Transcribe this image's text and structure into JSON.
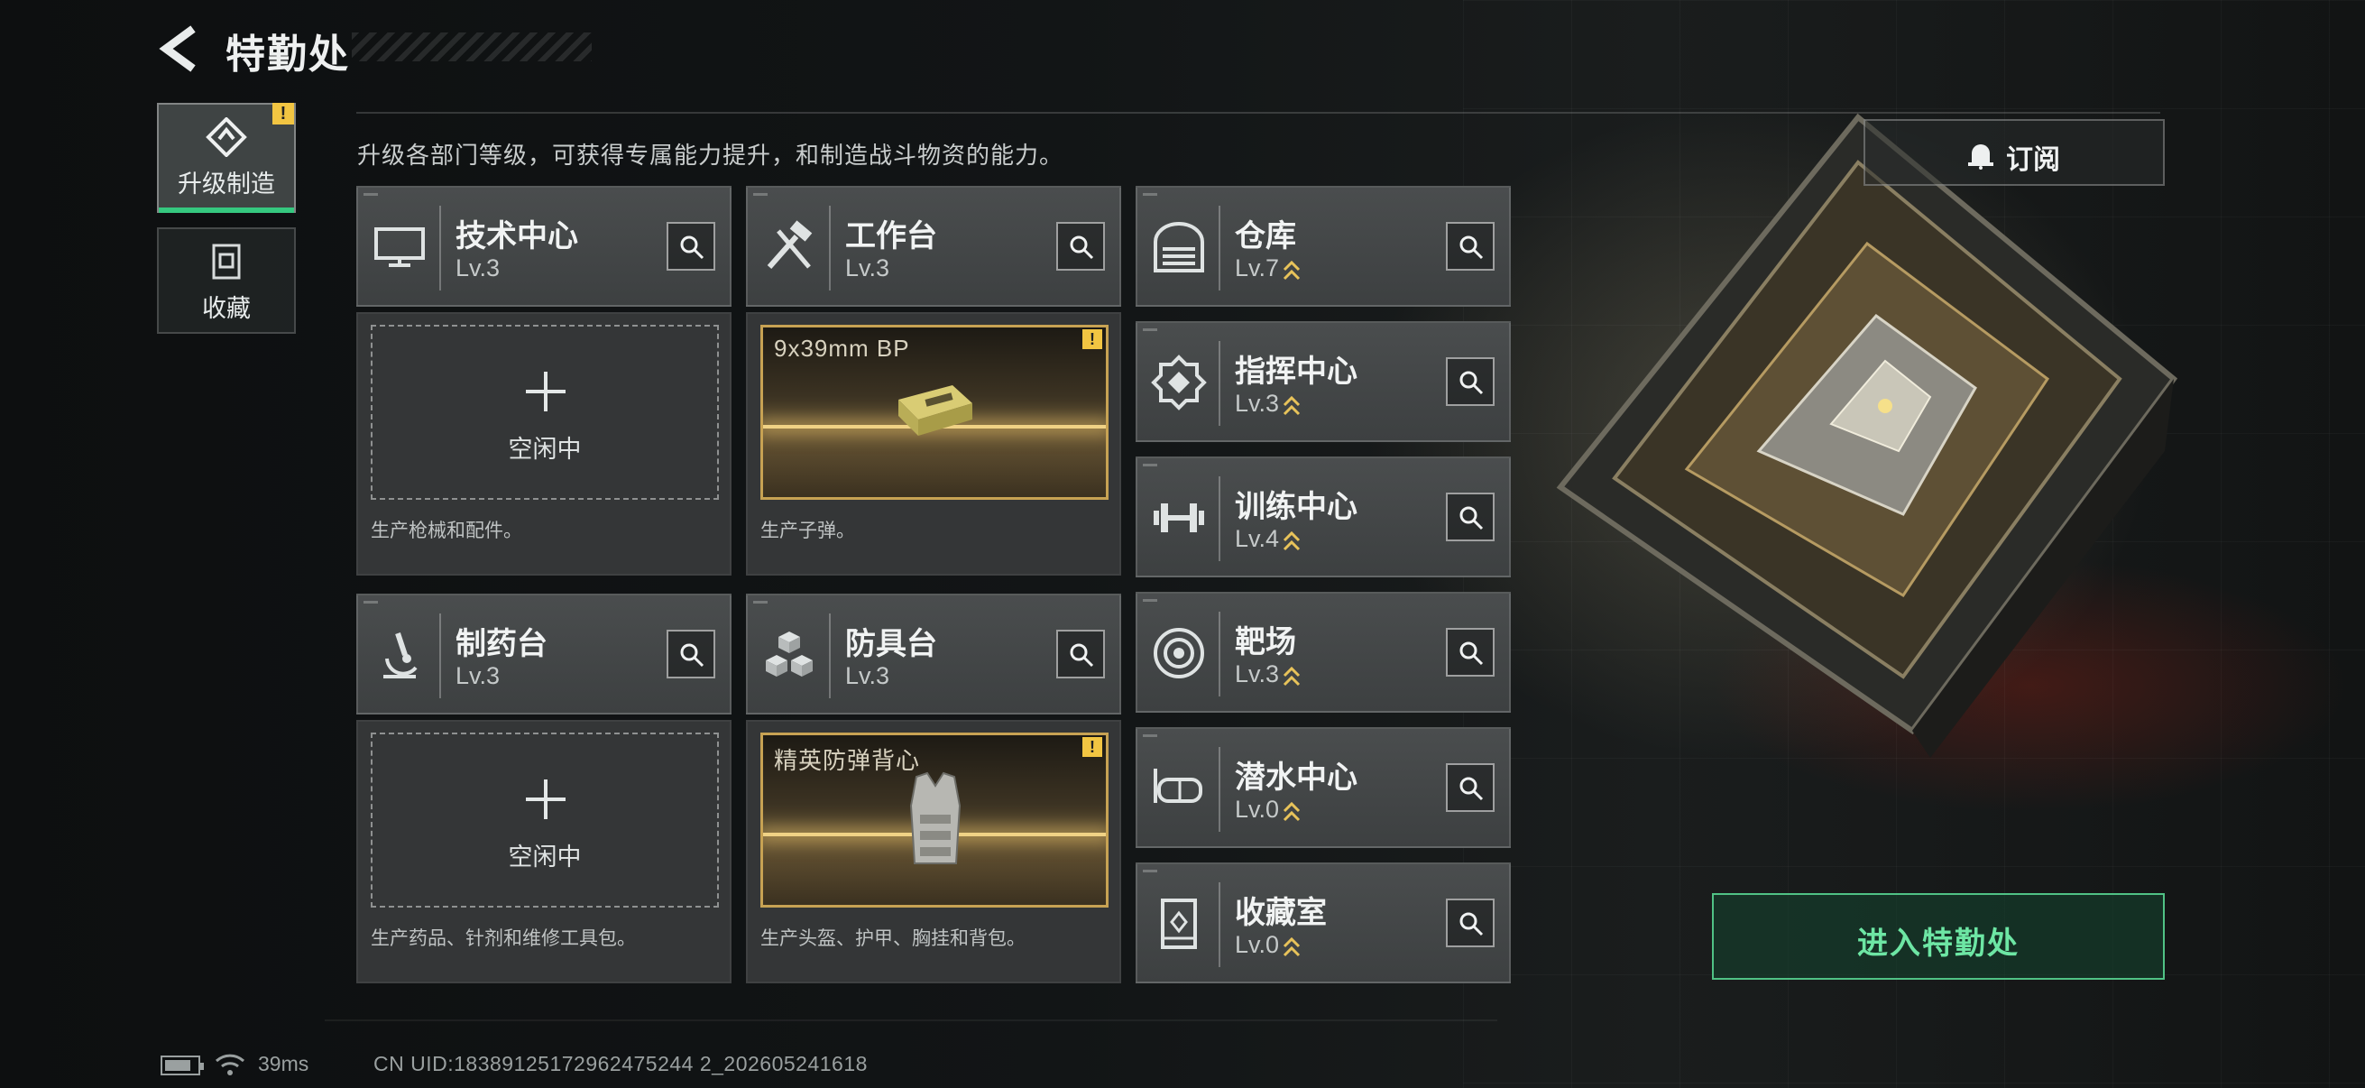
{
  "header": {
    "title": "特勤处"
  },
  "sidebar": {
    "tabs": [
      {
        "label": "升级制造",
        "active": true,
        "badge": "!"
      },
      {
        "label": "收藏",
        "active": false
      }
    ]
  },
  "subtitle": "升级各部门等级，可获得专属能力提升，和制造战斗物资的能力。",
  "facilities": {
    "tech_center": {
      "name": "技术中心",
      "level": "Lv.3"
    },
    "workbench": {
      "name": "工作台",
      "level": "Lv.3"
    },
    "pharmacy": {
      "name": "制药台",
      "level": "Lv.3"
    },
    "armor_bench": {
      "name": "防具台",
      "level": "Lv.3"
    },
    "warehouse": {
      "name": "仓库",
      "level": "Lv.7"
    },
    "command_center": {
      "name": "指挥中心",
      "level": "Lv.3"
    },
    "training_center": {
      "name": "训练中心",
      "level": "Lv.4"
    },
    "shooting_range": {
      "name": "靶场",
      "level": "Lv.3"
    },
    "diving_center": {
      "name": "潜水中心",
      "level": "Lv.0"
    },
    "collection_room": {
      "name": "收藏室",
      "level": "Lv.0"
    }
  },
  "production": {
    "tech_center": {
      "idle_text": "空闲中",
      "desc": "生产枪械和配件。"
    },
    "workbench": {
      "item_name": "9x39mm BP",
      "badge": "!",
      "desc": "生产子弹。"
    },
    "pharmacy": {
      "idle_text": "空闲中",
      "desc": "生产药品、针剂和维修工具包。"
    },
    "armor_bench": {
      "item_name": "精英防弹背心",
      "badge": "!",
      "desc": "生产头盔、护甲、胸挂和背包。"
    }
  },
  "actions": {
    "subscribe_label": "订阅",
    "enter_label": "进入特勤处"
  },
  "status": {
    "ping": "39ms",
    "uid": "CN UID:18389125172962475244 2_202605241618"
  },
  "colors": {
    "accent_green": "#35c87f",
    "badge_yellow": "#f2c542",
    "gold_frame": "#c7a253"
  }
}
